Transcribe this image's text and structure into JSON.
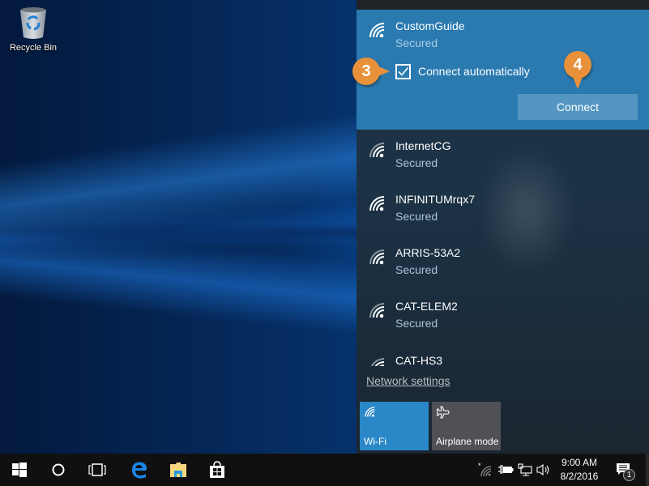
{
  "desktop": {
    "icons": [
      {
        "label": "Recycle Bin",
        "icon": "recycle-bin-icon"
      }
    ]
  },
  "network_flyout": {
    "selected_network": {
      "name": "CustomGuide",
      "status": "Secured",
      "icon": "wifi-signal-icon",
      "connect_automatically_label": "Connect automatically",
      "connect_automatically_checked": true,
      "connect_button_label": "Connect"
    },
    "networks": [
      {
        "name": "InternetCG",
        "status": "Secured",
        "icon": "wifi-signal-icon"
      },
      {
        "name": "INFINITUMrqx7",
        "status": "Secured",
        "icon": "wifi-signal-icon"
      },
      {
        "name": "ARRIS-53A2",
        "status": "Secured",
        "icon": "wifi-signal-icon"
      },
      {
        "name": "CAT-ELEM2",
        "status": "Secured",
        "icon": "wifi-signal-icon"
      },
      {
        "name": "CAT-HS3",
        "status": "",
        "icon": "wifi-signal-icon"
      }
    ],
    "network_settings_link": "Network settings",
    "quick_actions": [
      {
        "label": "Wi-Fi",
        "icon": "wifi-icon",
        "active": true
      },
      {
        "label": "Airplane mode",
        "icon": "airplane-icon",
        "active": false
      }
    ]
  },
  "callouts": [
    {
      "number": "3",
      "target": "connect-automatically-checkbox"
    },
    {
      "number": "4",
      "target": "connect-button"
    }
  ],
  "taskbar": {
    "buttons": [
      {
        "name": "start",
        "icon": "windows-start-icon"
      },
      {
        "name": "cortana",
        "icon": "cortana-search-icon"
      },
      {
        "name": "task-view",
        "icon": "task-view-icon"
      },
      {
        "name": "edge",
        "icon": "edge-browser-icon"
      },
      {
        "name": "file-explorer",
        "icon": "file-explorer-icon"
      },
      {
        "name": "store",
        "icon": "store-icon"
      }
    ],
    "tray": {
      "icons": [
        "wifi-available-icon",
        "battery-plugged-icon",
        "network-icon",
        "volume-icon"
      ],
      "time": "9:00 AM",
      "date": "8/2/2016",
      "notification_count": "1"
    }
  },
  "colors": {
    "accent": "#2a7ab0",
    "connect_button": "#5396c1",
    "wifi_tile": "#2b88c8",
    "airplane_tile": "#4f5156",
    "callout": "#e8913a",
    "taskbar": "#101010"
  }
}
